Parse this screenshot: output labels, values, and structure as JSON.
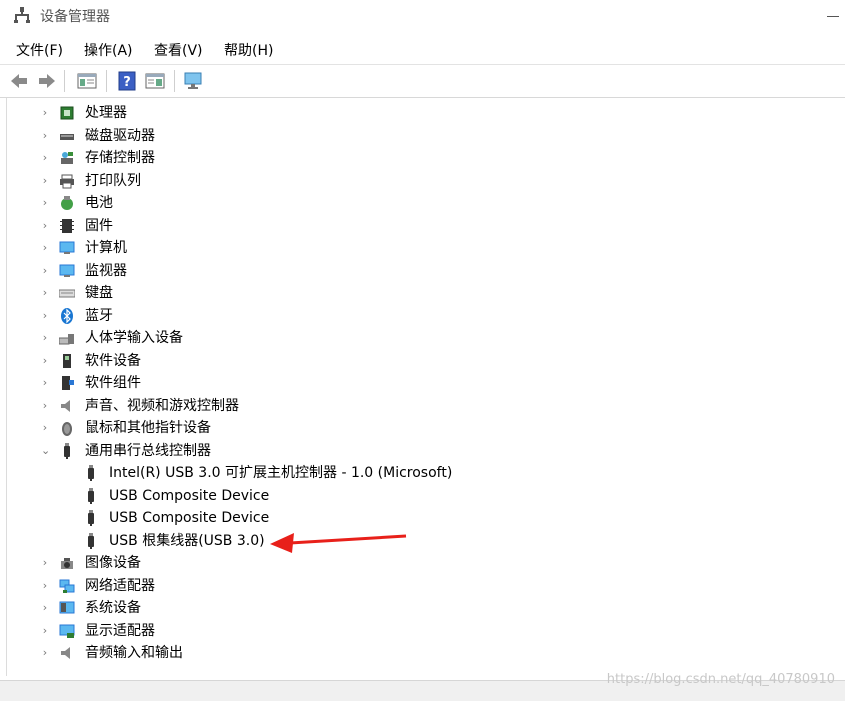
{
  "window": {
    "title": "设备管理器"
  },
  "menu": [
    "文件(F)",
    "操作(A)",
    "查看(V)",
    "帮助(H)"
  ],
  "toolbar_icons": [
    "back-icon",
    "forward-icon",
    "properties-icon",
    "help-icon",
    "show-hide-console-tree-icon",
    "monitor-icon"
  ],
  "tree": [
    {
      "label": "处理器",
      "icon": "cpu-icon",
      "expanded": false,
      "level": 0
    },
    {
      "label": "磁盘驱动器",
      "icon": "disk-drive-icon",
      "expanded": false,
      "level": 0
    },
    {
      "label": "存储控制器",
      "icon": "storage-controller-icon",
      "expanded": false,
      "level": 0
    },
    {
      "label": "打印队列",
      "icon": "printer-icon",
      "expanded": false,
      "level": 0
    },
    {
      "label": "电池",
      "icon": "battery-icon",
      "expanded": false,
      "level": 0
    },
    {
      "label": "固件",
      "icon": "firmware-icon",
      "expanded": false,
      "level": 0
    },
    {
      "label": "计算机",
      "icon": "computer-icon",
      "expanded": false,
      "level": 0
    },
    {
      "label": "监视器",
      "icon": "monitor-icon",
      "expanded": false,
      "level": 0
    },
    {
      "label": "键盘",
      "icon": "keyboard-icon",
      "expanded": false,
      "level": 0
    },
    {
      "label": "蓝牙",
      "icon": "bluetooth-icon",
      "expanded": false,
      "level": 0
    },
    {
      "label": "人体学输入设备",
      "icon": "hid-icon",
      "expanded": false,
      "level": 0
    },
    {
      "label": "软件设备",
      "icon": "software-device-icon",
      "expanded": false,
      "level": 0
    },
    {
      "label": "软件组件",
      "icon": "software-component-icon",
      "expanded": false,
      "level": 0
    },
    {
      "label": "声音、视频和游戏控制器",
      "icon": "speaker-icon",
      "expanded": false,
      "level": 0
    },
    {
      "label": "鼠标和其他指针设备",
      "icon": "mouse-icon",
      "expanded": false,
      "level": 0
    },
    {
      "label": "通用串行总线控制器",
      "icon": "usb-icon",
      "expanded": true,
      "level": 0
    },
    {
      "label": "Intel(R) USB 3.0 可扩展主机控制器 - 1.0 (Microsoft)",
      "icon": "usb-icon",
      "level": 1
    },
    {
      "label": "USB Composite Device",
      "icon": "usb-icon",
      "level": 1
    },
    {
      "label": "USB Composite Device",
      "icon": "usb-icon",
      "level": 1
    },
    {
      "label": "USB 根集线器(USB 3.0)",
      "icon": "usb-icon",
      "level": 1
    },
    {
      "label": "图像设备",
      "icon": "camera-icon",
      "expanded": false,
      "level": 0
    },
    {
      "label": "网络适配器",
      "icon": "network-adapter-icon",
      "expanded": false,
      "level": 0
    },
    {
      "label": "系统设备",
      "icon": "system-device-icon",
      "expanded": false,
      "level": 0
    },
    {
      "label": "显示适配器",
      "icon": "display-adapter-icon",
      "expanded": false,
      "level": 0
    },
    {
      "label": "音频输入和输出",
      "icon": "audio-io-icon",
      "expanded": false,
      "level": 0
    }
  ],
  "watermark": "https://blog.csdn.net/qq_40780910",
  "colors": {
    "accent": "#2a77d4",
    "annotation": "#e8201a"
  }
}
